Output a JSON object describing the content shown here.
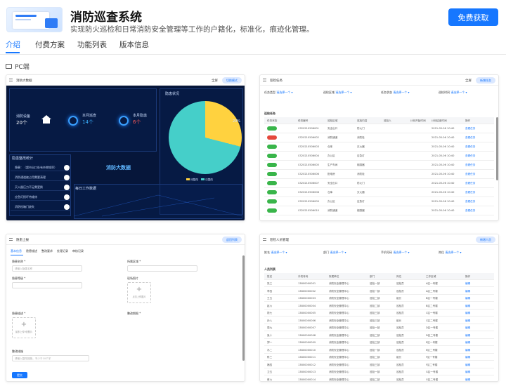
{
  "header": {
    "title": "消防巡查系统",
    "subtitle": "实现防火巡检和日常消防安全管理等工作的户籍化，标准化，痕迹化管理。",
    "free_button": "免费获取"
  },
  "tabs": [
    {
      "label": "介绍",
      "active": true
    },
    {
      "label": "付费方案",
      "active": false
    },
    {
      "label": "功能列表",
      "active": false
    },
    {
      "label": "版本信息",
      "active": false
    }
  ],
  "section_label": "PC端",
  "colors": {
    "accent": "#1677ff",
    "pie_yellow": "#ffd23f",
    "pie_teal": "#45cfc9",
    "dash_bg": "#06163a"
  },
  "shots": {
    "dashboard": {
      "title": "消防大数据",
      "full": "全屏",
      "pill": "切换模式",
      "sec_count_label": "消防设备",
      "sec_count": "20个",
      "stat1_label": "本月巡查",
      "stat1": "14个",
      "stat2_label": "本月隐患",
      "stat2": "6个",
      "pie_title": "隐患状况",
      "pie_pct": "29%",
      "center_title": "消防大数据",
      "list_title": "隐患整改统计",
      "bottom_title": "每日工作数据",
      "pie_data": [
        {
          "label": "待整改",
          "value": 29
        },
        {
          "label": "已整改",
          "value": 71
        }
      ],
      "list_items": [
        "隐患：（超市出口处有杂物堆积）",
        "消防通道被占用需要清理",
        "灭火器压力不足需更换",
        "应急灯损坏待维修",
        "消防栓箱门缺失"
      ]
    },
    "table": {
      "title": "巡检任务",
      "full": "全屏",
      "pill": "新增任务",
      "filters": [
        "任务类型",
        "请选择一个",
        "巡检区域",
        "请选择一个",
        "任务状态",
        "请选择一个",
        "巡检时间",
        "请选择一个"
      ],
      "section": "巡检任务",
      "columns": [
        "任务状态",
        "任务编号",
        "巡检区域",
        "巡检内容",
        "巡检人",
        "计划开始时间",
        "计划结束时间",
        "操作"
      ],
      "rows": [
        {
          "status": "green",
          "id": "CS20210506001",
          "area": "安全出口",
          "content": "防火门",
          "time": "2021-05-06 10:40",
          "op": "查看任务"
        },
        {
          "status": "red",
          "id": "CS20210506002",
          "area": "消防通道",
          "content": "消防栓",
          "time": "2021-05-06 10:40",
          "op": "查看任务"
        },
        {
          "status": "green",
          "id": "CS20210506003",
          "area": "仓库",
          "content": "灭火器",
          "time": "2021-05-06 10:40",
          "op": "查看任务"
        },
        {
          "status": "green",
          "id": "CS20210506004",
          "area": "办公区",
          "content": "应急灯",
          "time": "2021-05-06 10:40",
          "op": "查看任务"
        },
        {
          "status": "green",
          "id": "CS20210506005",
          "area": "生产车间",
          "content": "烟感器",
          "time": "2021-05-06 10:40",
          "op": "查看任务"
        },
        {
          "status": "green",
          "id": "CS20210506006",
          "area": "配电房",
          "content": "消防栓",
          "time": "2021-05-06 10:40",
          "op": "查看任务"
        },
        {
          "status": "green",
          "id": "CS20210506007",
          "area": "安全出口",
          "content": "防火门",
          "time": "2021-05-06 10:40",
          "op": "查看任务"
        },
        {
          "status": "green",
          "id": "CS20210506008",
          "area": "仓库",
          "content": "灭火器",
          "time": "2021-05-06 10:40",
          "op": "查看任务"
        },
        {
          "status": "green",
          "id": "CS20210506009",
          "area": "办公区",
          "content": "应急灯",
          "time": "2021-05-06 10:40",
          "op": "查看任务"
        },
        {
          "status": "green",
          "id": "CS20210506010",
          "area": "消防通道",
          "content": "烟感器",
          "time": "2021-05-06 10:40",
          "op": "查看任务"
        }
      ]
    },
    "form": {
      "title": "隐患上报",
      "pill": "返回列表",
      "subtabs": [
        "基本信息",
        "隐患描述",
        "整改要求",
        "处理记录",
        "审核记录"
      ],
      "f1": "隐患名称 *",
      "f1_ph": "请输入隐患名称",
      "f2": "所属区域 *",
      "f3": "隐患等级 *",
      "f4": "现场照片",
      "up1": "点击上传图片",
      "up2": "最多上传9张照片",
      "f5": "隐患描述 *",
      "f6": "整改期限 *",
      "f7": "整改措施",
      "f7_ph": "请输入整改措施，不少于10个字",
      "submit": "提交"
    },
    "people": {
      "title": "巡检人员管理",
      "pill": "新增人员",
      "filters": [
        "姓名",
        "请选择一个",
        "部门",
        "请选择一个",
        "手机号码",
        "请选择一个",
        "岗位",
        "请选择一个"
      ],
      "section": "人员列表",
      "columns": [
        "姓名",
        "手机号码",
        "所属单位",
        "部门",
        "岗位",
        "工作区域",
        "操作"
      ],
      "rows": [
        [
          "张三",
          "13800000001",
          "消防安全管理中心",
          "巡检一部",
          "巡检员",
          "A区一号楼",
          "编辑"
        ],
        [
          "李四",
          "13800000002",
          "消防安全管理中心",
          "巡检一部",
          "巡检员",
          "A区二号楼",
          "编辑"
        ],
        [
          "王五",
          "13800000003",
          "消防安全管理中心",
          "巡检二部",
          "组长",
          "B区一号楼",
          "编辑"
        ],
        [
          "赵六",
          "13800000004",
          "消防安全管理中心",
          "巡检二部",
          "巡检员",
          "B区二号楼",
          "编辑"
        ],
        [
          "钱七",
          "13800000005",
          "消防安全管理中心",
          "巡检三部",
          "巡检员",
          "C区一号楼",
          "编辑"
        ],
        [
          "孙八",
          "13800000006",
          "消防安全管理中心",
          "巡检三部",
          "组长",
          "C区二号楼",
          "编辑"
        ],
        [
          "周九",
          "13800000007",
          "消防安全管理中心",
          "巡检一部",
          "巡检员",
          "D区一号楼",
          "编辑"
        ],
        [
          "吴十",
          "13800000008",
          "消防安全管理中心",
          "巡检二部",
          "巡检员",
          "D区二号楼",
          "编辑"
        ],
        [
          "郑一",
          "13800000009",
          "消防安全管理中心",
          "巡检三部",
          "巡检员",
          "E区一号楼",
          "编辑"
        ],
        [
          "冯二",
          "13800000010",
          "消防安全管理中心",
          "巡检一部",
          "巡检员",
          "E区二号楼",
          "编辑"
        ],
        [
          "陈三",
          "13800000011",
          "消防安全管理中心",
          "巡检二部",
          "组长",
          "F区一号楼",
          "编辑"
        ],
        [
          "褚四",
          "13800000012",
          "消防安全管理中心",
          "巡检三部",
          "巡检员",
          "F区二号楼",
          "编辑"
        ],
        [
          "卫五",
          "13800000013",
          "消防安全管理中心",
          "巡检一部",
          "巡检员",
          "G区一号楼",
          "编辑"
        ],
        [
          "蒋六",
          "13800000014",
          "消防安全管理中心",
          "巡检二部",
          "巡检员",
          "G区二号楼",
          "编辑"
        ]
      ]
    }
  }
}
